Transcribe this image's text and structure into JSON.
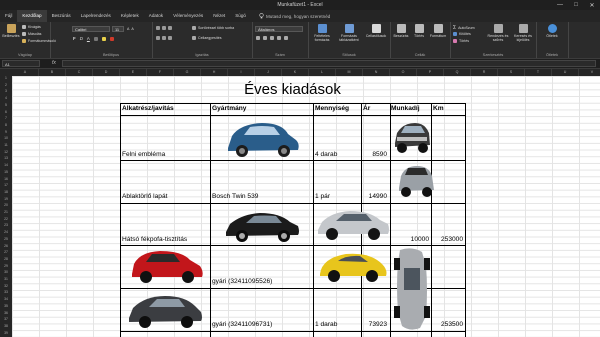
{
  "window": {
    "title": "Munkafüzet1 - Excel",
    "controls": [
      "—",
      "□",
      "✕"
    ]
  },
  "menu": {
    "tabs": [
      "Fájl",
      "Kezdőlap",
      "Beszúrás",
      "Lapelrendezés",
      "Képletek",
      "Adatok",
      "Véleményezés",
      "Nézet",
      "Súgó"
    ],
    "active_tab": "Kezdőlap",
    "tell_me": "Mutasd meg, hogyan szeretnéd"
  },
  "ribbon": {
    "clipboard": {
      "paste": "Beillesztés",
      "cut": "Kivágás",
      "copy": "Másolás",
      "format_painter": "Formátummásoló",
      "label": "Vágólap"
    },
    "font": {
      "name": "Calibri",
      "size": "11",
      "bold": "F",
      "italic": "D",
      "underline": "A",
      "label": "Betűtípus"
    },
    "alignment": {
      "wrap": "Sortöréssel több sorba",
      "merge": "Cellaegyesítés",
      "label": "Igazítás"
    },
    "number": {
      "format": "Általános",
      "label": "Szám"
    },
    "styles": {
      "conditional": "Feltételes formázás",
      "format_table": "Formázás táblázatként",
      "cell_styles": "Cellastílusok",
      "label": "Stílusok"
    },
    "cells": {
      "insert": "Beszúrás",
      "delete": "Törlés",
      "format": "Formátum",
      "label": "Cellák"
    },
    "editing": {
      "autosum": "AutoSzum",
      "fill": "Kitöltés",
      "clear": "Törlés",
      "sort": "Rendezés és szűrés",
      "find": "Keresés és kijelölés",
      "label": "Szerkesztés"
    },
    "ideas": {
      "button": "Ötletek",
      "label": "Ötletek"
    }
  },
  "formula_bar": {
    "cell_ref": "A1",
    "fx": "fx",
    "content": ""
  },
  "columns": [
    "A",
    "B",
    "C",
    "D",
    "E",
    "F",
    "G",
    "H",
    "I",
    "J",
    "K",
    "L",
    "M",
    "N",
    "O",
    "P",
    "Q",
    "R",
    "S",
    "T",
    "U",
    "V"
  ],
  "rows": [
    "1",
    "2",
    "3",
    "4",
    "5",
    "6",
    "7",
    "8",
    "9",
    "10",
    "11",
    "12",
    "13",
    "14",
    "15",
    "16",
    "17",
    "18",
    "19",
    "20",
    "21",
    "22",
    "23",
    "24",
    "25",
    "26",
    "27",
    "28",
    "29",
    "30",
    "31",
    "32",
    "33",
    "34",
    "35",
    "36",
    "37",
    "38",
    "39"
  ],
  "sheet": {
    "title": "Éves kiadások",
    "headers": {
      "part": "Alkatrész/javítás",
      "maker": "Gyártmány",
      "qty": "Mennyiség",
      "price": "Ár",
      "labor": "Munkadíj",
      "km": "Km"
    },
    "rows": [
      {
        "part": "Felni embléma",
        "maker": "",
        "qty": "4 darab",
        "price": "8590",
        "labor": "",
        "km": ""
      },
      {
        "part": "Ablaktörlő lapát",
        "maker": "Bosch Twin 539",
        "qty": "1 pár",
        "price": "14990",
        "labor": "",
        "km": ""
      },
      {
        "part": "Hátsó fékpofa-tisztítás",
        "maker": "",
        "qty": "",
        "price": "",
        "labor": "10000",
        "km": "253000"
      },
      {
        "part": "",
        "maker": "gyári (32411095526)",
        "qty": "",
        "price": "",
        "labor": "",
        "km": ""
      },
      {
        "part": "",
        "maker": "gyári (32411096731)",
        "qty": "1 darab",
        "price": "73923",
        "labor": "",
        "km": "253500"
      }
    ],
    "car_images": [
      "car-photo-blue-hatchback",
      "car-photo-vintage-mercedes",
      "car-photo-silver-mini",
      "car-photo-black-sedan",
      "car-photo-silver-sedan",
      "car-photo-red-hatchback",
      "car-photo-yellow-beetle",
      "car-photo-dark-sedan",
      "car-photo-silver-vertical"
    ]
  }
}
